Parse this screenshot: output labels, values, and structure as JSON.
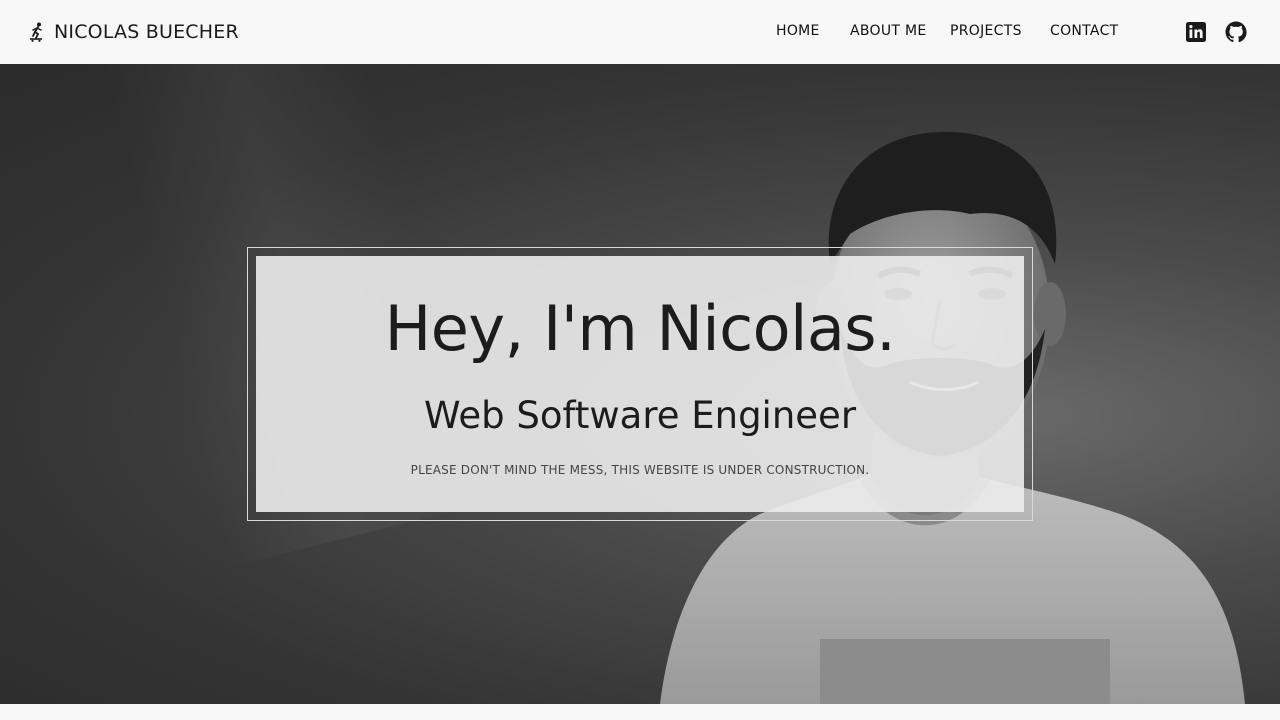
{
  "brand": {
    "name": "NICOLAS BUECHER",
    "icon": "skateboarder-icon"
  },
  "nav": {
    "items": [
      {
        "label": "HOME"
      },
      {
        "label": "ABOUT ME"
      },
      {
        "label": "PROJECTS"
      },
      {
        "label": "CONTACT"
      }
    ]
  },
  "social": [
    {
      "icon": "linkedin-icon"
    },
    {
      "icon": "github-icon"
    }
  ],
  "hero": {
    "title": "Hey, I'm Nicolas.",
    "subtitle": "Web Software Engineer",
    "note": "PLEASE DON'T MIND THE MESS, THIS WEBSITE IS UNDER CONSTRUCTION."
  },
  "colors": {
    "navbar_bg": "#f8f8f8",
    "text": "#1c1c1c",
    "hero_bg": "#343434",
    "card_bg": "#ececec"
  }
}
